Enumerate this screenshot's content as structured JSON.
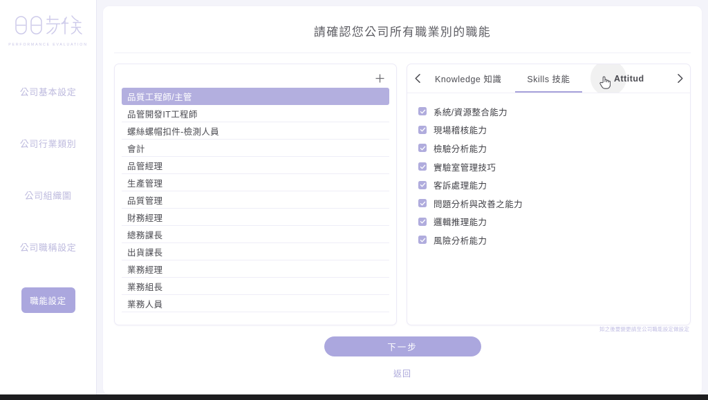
{
  "brand": {
    "logo_text": "日日考核",
    "logo_subtitle": "PERFORMANCE EVALUATION"
  },
  "sidebar": {
    "items": [
      {
        "label": "公司基本設定",
        "active": false
      },
      {
        "label": "公司行業類別",
        "active": false
      },
      {
        "label": "公司組織圖",
        "active": false
      },
      {
        "label": "公司職稱設定",
        "active": false
      },
      {
        "label": "職能設定",
        "active": true
      }
    ]
  },
  "header": {
    "title": "請確認您公司所有職業別的職能"
  },
  "jobs_panel": {
    "add_icon": "plus-icon",
    "selected_index": 0,
    "items": [
      "品質工程師/主管",
      "品管開發IT工程師",
      "螺絲螺帽扣件-檢測人員",
      "會計",
      "品管經理",
      "生產管理",
      "品質管理",
      "財務經理",
      "總務課長",
      "出貨課長",
      "業務經理",
      "業務組長",
      "業務人員"
    ]
  },
  "competency_panel": {
    "prev_icon": "chevron-left-icon",
    "next_icon": "chevron-right-icon",
    "active_tab_index": 1,
    "hovered_tab_index": 2,
    "tabs": [
      {
        "label": "Knowledge 知識"
      },
      {
        "label": "Skills 技能"
      },
      {
        "label": "Attitud"
      }
    ],
    "items": [
      {
        "label": "系統/資源整合能力",
        "checked": true
      },
      {
        "label": "現場稽核能力",
        "checked": true
      },
      {
        "label": "檢驗分析能力",
        "checked": true
      },
      {
        "label": "實驗室管理技巧",
        "checked": true
      },
      {
        "label": "客訴處理能力",
        "checked": true
      },
      {
        "label": "問題分析與改善之能力",
        "checked": true
      },
      {
        "label": "邏輯推理能力",
        "checked": true
      },
      {
        "label": "風險分析能力",
        "checked": true
      }
    ]
  },
  "footer": {
    "hint": "如之後要變更請至公司職能設定做設定",
    "next_label": "下一步",
    "back_label": "返回"
  },
  "colors": {
    "accent": "#aba7de",
    "accent_light": "#b3afdf",
    "nav_text": "#bdbade",
    "page_bg": "#f4f4fa",
    "title_text": "#5d5d63"
  }
}
